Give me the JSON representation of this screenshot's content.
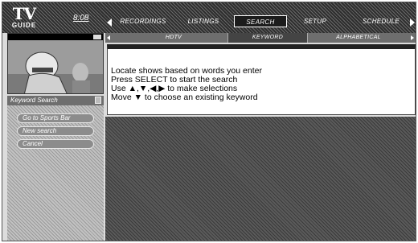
{
  "header": {
    "logo_top": "TV",
    "logo_bottom": "GUIDE",
    "clock": "8:08",
    "tabs": [
      {
        "label": "RECORDINGS"
      },
      {
        "label": "LISTINGS"
      },
      {
        "label": "SEARCH"
      },
      {
        "label": "SETUP"
      },
      {
        "label": "SCHEDULE"
      }
    ]
  },
  "sidebar": {
    "title": "Keyword Search",
    "buttons": [
      {
        "label": "Go to Sports Bar"
      },
      {
        "label": "New search"
      },
      {
        "label": "Cancel"
      }
    ]
  },
  "subtabs": [
    {
      "label": "HDTV"
    },
    {
      "label": "KEYWORD"
    },
    {
      "label": "ALPHABETICAL"
    }
  ],
  "instructions": [
    "Locate shows based on words you enter",
    "Press SELECT to start the search",
    "Use ▲,▼,◀,▶ to make selections",
    "Move ▼ to choose an existing keyword"
  ],
  "colors": {
    "active_tab": "#1c1c1c",
    "panel": "#c2c2c2"
  }
}
